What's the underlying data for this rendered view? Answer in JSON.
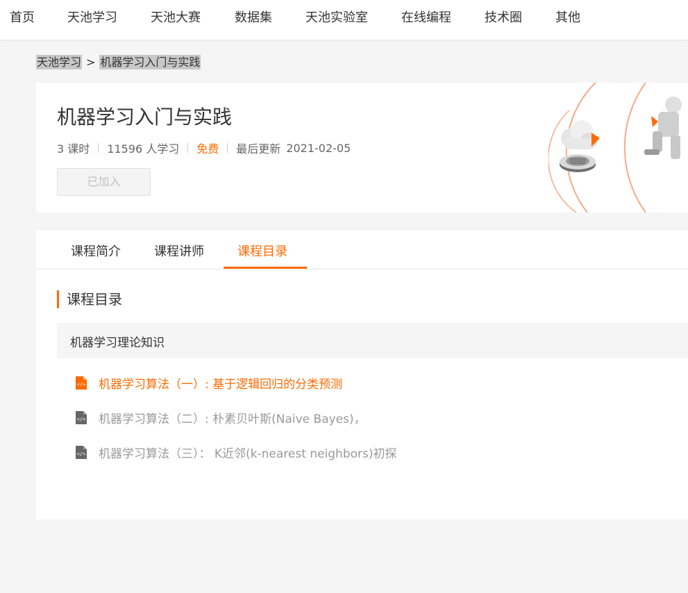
{
  "nav": {
    "items": [
      "首页",
      "天池学习",
      "天池大赛",
      "数据集",
      "天池实验室",
      "在线编程",
      "技术圈",
      "其他"
    ]
  },
  "breadcrumb": {
    "items": [
      "天池学习",
      "机器学习入门与实践"
    ],
    "separator": ">"
  },
  "course": {
    "title": "机器学习入门与实践",
    "lessons_count": "3 课时",
    "learners": "11596 人学习",
    "price": "免费",
    "updated_label": "最后更新",
    "updated_date": "2021-02-05",
    "join_button": "已加入"
  },
  "tabs": {
    "items": [
      "课程简介",
      "课程讲师",
      "课程目录"
    ],
    "active": "课程目录"
  },
  "catalog": {
    "heading": "课程目录",
    "chapter": "机器学习理论知识",
    "lessons": [
      "机器学习算法（一）: 基于逻辑回归的分类预测",
      "机器学习算法（二）: 朴素贝叶斯(Naive Bayes)，",
      "机器学习算法（三）： K近邻(k-nearest neighbors)初探"
    ]
  },
  "colors": {
    "accent": "#ff6a00",
    "muted_text": "#999999",
    "background": "#f5f5f5"
  },
  "icons": {
    "lesson_icon": "code-document-icon",
    "banner": "cloud-robot-illustration"
  }
}
